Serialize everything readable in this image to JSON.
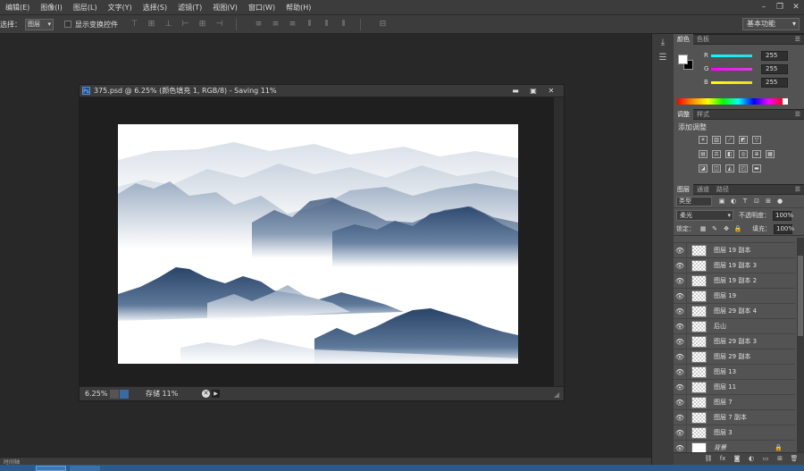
{
  "menu": {
    "items": [
      "编辑(E)",
      "图像(I)",
      "图层(L)",
      "文字(Y)",
      "选择(S)",
      "滤镜(T)",
      "视图(V)",
      "窗口(W)",
      "帮助(H)"
    ]
  },
  "options": {
    "select_label": "选择：",
    "select_value": "图层",
    "show_transform": "显示变换控件",
    "workspace": "基本功能"
  },
  "document": {
    "title": "375.psd @ 6.25% (颜色填充 1, RGB/8) - Saving 11%",
    "zoom": "6.25%",
    "status": "存储 11%"
  },
  "color_panel": {
    "tabs": [
      "颜色",
      "色板"
    ],
    "channels": [
      {
        "label": "R",
        "value": "255",
        "color": "#36d6e8"
      },
      {
        "label": "G",
        "value": "255",
        "color": "#d840d8"
      },
      {
        "label": "B",
        "value": "255",
        "color": "#e8e020"
      }
    ]
  },
  "adjust_panel": {
    "tabs": [
      "调整",
      "样式"
    ],
    "title": "添加调整"
  },
  "layers_panel": {
    "tabs": [
      "图层",
      "通道",
      "路径"
    ],
    "kind": "类型",
    "blend": "柔光",
    "opacity_label": "不透明度：",
    "opacity": "100%",
    "lock_label": "锁定：",
    "fill_label": "填充：",
    "fill": "100%",
    "layers": [
      {
        "name": "图层 19 副本"
      },
      {
        "name": "图层 19 副本 3"
      },
      {
        "name": "图层 19 副本 2"
      },
      {
        "name": "图层 19"
      },
      {
        "name": "图层 29 副本 4"
      },
      {
        "name": "后山"
      },
      {
        "name": "图层 29 副本 3"
      },
      {
        "name": "图层 29 副本"
      },
      {
        "name": "图层 13"
      },
      {
        "name": "图层 11"
      },
      {
        "name": "图层 7"
      },
      {
        "name": "图层 7 副本"
      },
      {
        "name": "图层 3"
      },
      {
        "name": "背景"
      }
    ]
  },
  "timeline": {
    "label": "时间轴"
  }
}
